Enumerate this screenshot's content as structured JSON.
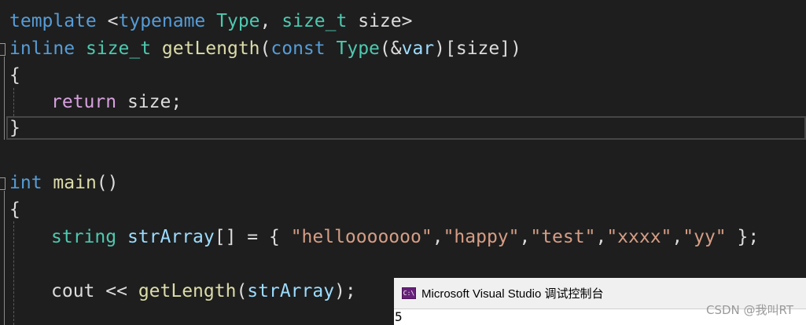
{
  "code": {
    "line1": {
      "t1": "template",
      "t2": "<",
      "t3": "typename",
      "t4": "Type",
      "t5": ",",
      "t6": "size_t",
      "t7": "size",
      "t8": ">"
    },
    "line2": {
      "t1": "inline",
      "t2": "size_t",
      "t3": "getLength",
      "t4": "(",
      "t5": "const",
      "t6": "Type",
      "t7": "(&",
      "t8": "var",
      "t9": ")[",
      "t10": "size",
      "t11": "])"
    },
    "line3": {
      "t1": "{"
    },
    "line4": {
      "t1": "return",
      "t2": "size",
      "t3": ";"
    },
    "line5": {
      "t1": "}"
    },
    "line7": {
      "t1": "int",
      "t2": "main",
      "t3": "()"
    },
    "line8": {
      "t1": "{"
    },
    "line9": {
      "t1": "string",
      "t2": "strArray",
      "t3": "[] = {",
      "t4": "\"hellooooooo\"",
      "t5": ",",
      "t6": "\"happy\"",
      "t7": ",",
      "t8": "\"test\"",
      "t9": ",",
      "t10": "\"xxxx\"",
      "t11": ",",
      "t12": "\"yy\"",
      "t13": "};"
    },
    "line11": {
      "t1": "cout",
      "t2": "<<",
      "t3": "getLength",
      "t4": "(",
      "t5": "strArray",
      "t6": ");"
    }
  },
  "console": {
    "icon_label": "C:\\",
    "title": "Microsoft Visual Studio 调试控制台",
    "output": "5"
  },
  "watermark": "CSDN @我叫RT",
  "icons": {
    "fold": "collapse-marker-icon",
    "console": "console-app-icon"
  }
}
